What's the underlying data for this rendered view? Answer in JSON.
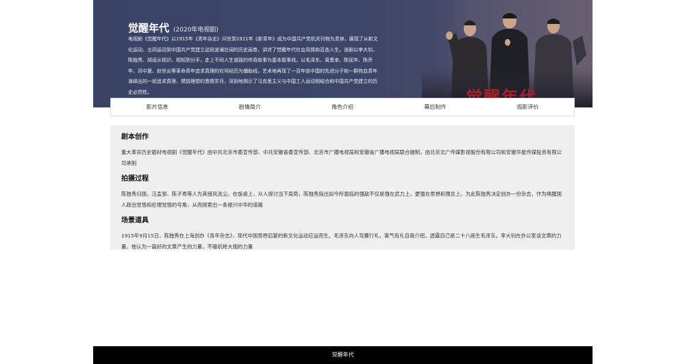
{
  "hero": {
    "title": "觉醒年代",
    "subtitle": "(2020年电视剧)",
    "description": "电视剧《觉醒年代》以1915年《青年杂志》问世到1921年《新青年》成为中国共产党机关刊物为贯穿，展现了从新文化运动、五四运动到中国共产党建立这段波澜壮阔的历史画卷，讲述了觉醒年代社会风情和百态人生。该剧以李大钊、陈独秀、胡适从相识、相知到分手，走上不同人生道路的传奇故事为基本叙事线，以毛泽东、周恩来、陈延年、陈乔年、邓中夏、赵世炎等革命青年追求真理的坎坷经历为辅助线，艺术地再现了一百年前中国的先进分子和一群热血青年演绎出的一段追求真理、燃烧理想的激情岁月，深刻地揭示了马克思主义与中国工人运动相结合和中国共产党建立的历史必然性。",
    "poster_text": "觉醒年代"
  },
  "tabs": [
    {
      "label": "影片信息"
    },
    {
      "label": "剧情简介"
    },
    {
      "label": "角色介绍"
    },
    {
      "label": "幕后制作"
    },
    {
      "label": "观影评价"
    }
  ],
  "sections": [
    {
      "title": "剧本创作",
      "body": "重大革命历史题材电视剧《觉醒年代》由中共北京市委宣传部、中共安徽省委宣传部、北京市广播电视局和安徽省广播电视局联合摄制，由北京北广传媒影视股份有限公司和安徽华星传媒投资有限公司承制"
    },
    {
      "title": "拍摄过程",
      "body": "陈独秀归国，汪孟邹、陈子寿等人为其接风洗尘。在饭桌上，众人探讨当下局势，陈独秀指出如今所面临的强敌不仅是强在武力上，更强在思想和理念上。为此陈独秀决定创办一份杂志，作为唤醒国人政治觉悟和伦理觉悟的号角，从而探索出一条振兴中华的道路"
    },
    {
      "title": "场景道具",
      "body": "1915年9月15日，陈独秀在上海创办《青年杂志》，现代中国思想启蒙的新文化运动应运而生。毛泽东向人弯腰行礼，客气有礼自我介绍，透露自己是二十八画生毛泽东。李大钊在办公室谈文章的力量，他认为一篇好的文章产生的力量，不输机枪大炮的力量"
    }
  ],
  "footer": {
    "text": "觉醒年代"
  }
}
